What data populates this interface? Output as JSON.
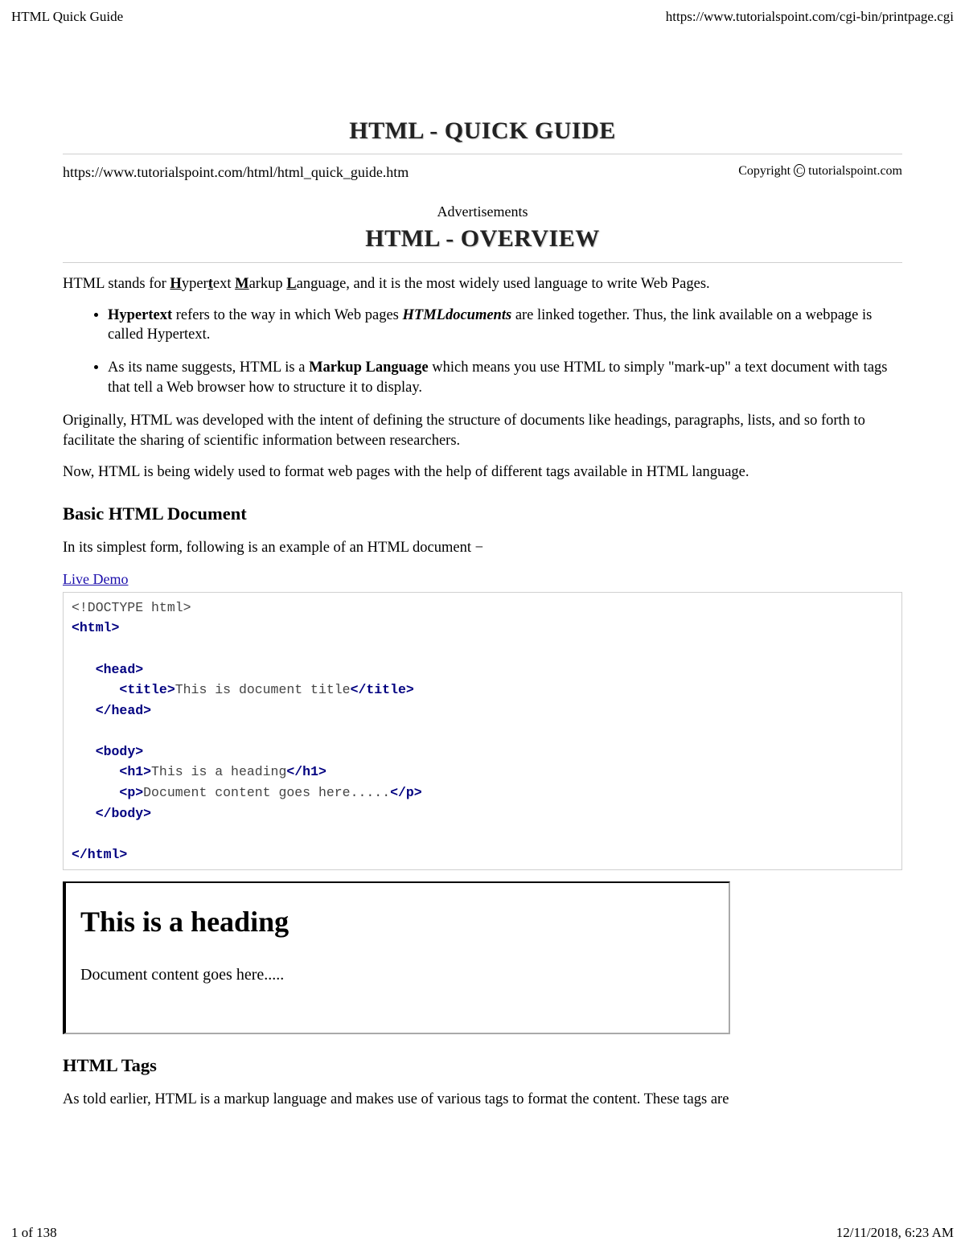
{
  "header": {
    "left": "HTML Quick Guide",
    "right": "https://www.tutorialspoint.com/cgi-bin/printpage.cgi"
  },
  "footer": {
    "left": "1 of 138",
    "right": "12/11/2018, 6:23 AM"
  },
  "title_main": "HTML - QUICK GUIDE",
  "source_url": "https://www.tutorialspoint.com/html/html_quick_guide.htm",
  "copyright_label": "Copyright ",
  "copyright_owner": " tutorialspoint.com",
  "ads_label": "Advertisements",
  "title_section": "HTML - OVERVIEW",
  "intro": {
    "pre": "HTML stands for ",
    "h": "H",
    "yper": "yper",
    "t": "t",
    "ext": "ext ",
    "m": "M",
    "arkup": "arkup ",
    "l": "L",
    "anguage": "anguage, and it is the most widely used language to write Web Pages."
  },
  "bullets": {
    "b1_bold": "Hypertext",
    "b1_mid": " refers to the way in which Web pages ",
    "b1_ital": "HTMLdocuments",
    "b1_end": " are linked together. Thus, the link available on a webpage is called Hypertext.",
    "b2_start": "As its name suggests, HTML is a ",
    "b2_bold": "Markup Language",
    "b2_end": " which means you use HTML to simply \"mark-up\" a text document with tags that tell a Web browser how to structure it to display."
  },
  "para_orig": "Originally, HTML was developed with the intent of defining the structure of documents like headings, paragraphs, lists, and so forth to facilitate the sharing of scientific information between researchers.",
  "para_now": "Now, HTML is being widely used to format web pages with the help of different tags available in HTML language.",
  "subhead_basic": "Basic HTML Document",
  "para_simple": "In its simplest form, following is an example of an HTML document −",
  "live_demo": "Live Demo",
  "code": {
    "doctype": "<!DOCTYPE html>",
    "html_open": "<html>",
    "head_open": "<head>",
    "title_open": "<title>",
    "title_text": "This is document title",
    "title_close": "</title>",
    "head_close": "</head>",
    "body_open": "<body>",
    "h1_open": "<h1>",
    "h1_text": "This is a heading",
    "h1_close": "</h1>",
    "p_open": "<p>",
    "p_text": "Document content goes here.....",
    "p_close": "</p>",
    "body_close": "</body>",
    "html_close": "</html>"
  },
  "output": {
    "heading": "This is a heading",
    "para": "Document content goes here....."
  },
  "subhead_tags": "HTML Tags",
  "para_tags": "As told earlier, HTML is a markup language and makes use of various tags to format the content. These tags are"
}
